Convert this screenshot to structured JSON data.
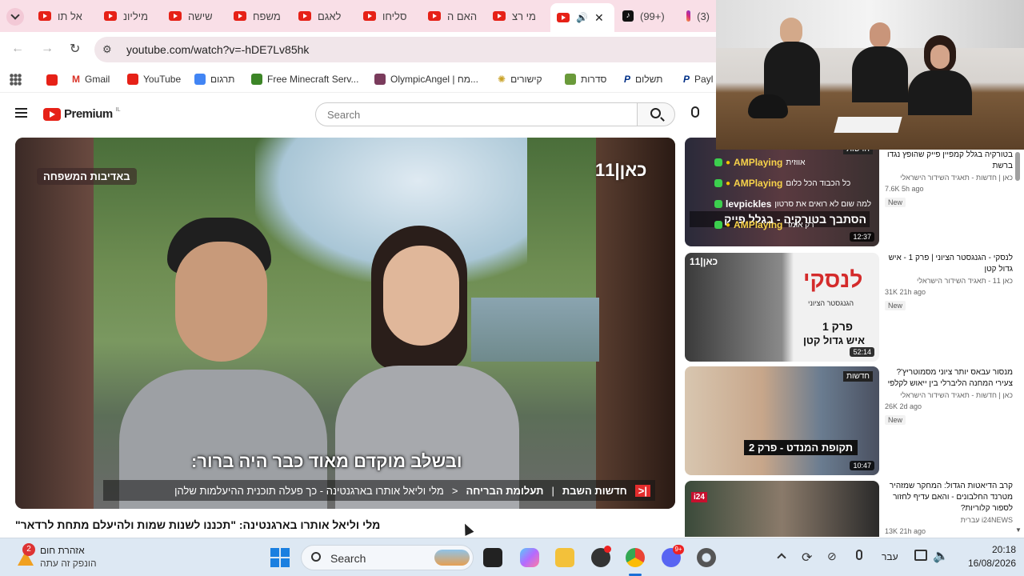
{
  "tabs": [
    {
      "label": "אל תו"
    },
    {
      "label": "מיליונ"
    },
    {
      "label": "שישה"
    },
    {
      "label": "משפח"
    },
    {
      "label": "לאגם"
    },
    {
      "label": "סליחו"
    },
    {
      "label": "האם ה"
    },
    {
      "label": "מי רצ"
    },
    {
      "label": ""
    },
    {
      "label": "(99+)"
    },
    {
      "label": "(3)"
    }
  ],
  "address": {
    "url": "youtube.com/watch?v=-hDE7Lv85hk"
  },
  "bookmarks": [
    {
      "label": "Gmail"
    },
    {
      "label": "YouTube"
    },
    {
      "label": "תרגום"
    },
    {
      "label": "Free Minecraft Serv..."
    },
    {
      "label": "OlympicAngel | מח..."
    },
    {
      "label": "קישורים"
    },
    {
      "label": "סדרות"
    },
    {
      "label": "תשלום"
    },
    {
      "label": "Payl"
    }
  ],
  "yt": {
    "brand": "Premium",
    "region": "IL",
    "search_placeholder": "Search"
  },
  "player": {
    "corner_tag": "באדיבות המשפחה",
    "channel_logo": "כאן|11",
    "subtitle": "ובשלב מוקדם מאוד כבר היה ברור:",
    "ticker_source": "חדשות השבת",
    "ticker_section": "תעלומת הבריחה",
    "ticker_text": "מלי וליאל אותרו בארגנטינה - כך פעלה תוכנית ההיעלמות שלהן"
  },
  "video_title": "\"מלי וליאל אותרו בארגנטינה: \"תכננו לשנות שמות ולהיעלם מתחת לרדאר",
  "overlay": {
    "chat_lines": [
      {
        "user": "AMPlaying",
        "text": "אווזית"
      },
      {
        "user": "AMPlaying",
        "text": "כל הכבוד הכל כלום"
      },
      {
        "user": "levpickles",
        "text": "למה שום לא רואים את סרטון"
      },
      {
        "user": "AMPlaying",
        "text": "רק אומר"
      }
    ]
  },
  "sidebar": [
    {
      "title": "בטורקיה בגלל קמפיין פייק שהופץ נגדו ברשת",
      "channel": "כאן | חדשות - תאגיד השידור הישראלי",
      "meta": "7.6K  5h ago",
      "badge": "New",
      "duration": "12:37",
      "thumb_text": "הסתבך בטורקיה - בגלל פייק",
      "thumb_tag": "חדשות"
    },
    {
      "title": "לנסקי - הגנגסטר הציוני | פרק 1 - איש גדול קטן",
      "channel": "כאן 11 - תאגיד השידור הישראלי",
      "meta": "31K  21h ago",
      "badge": "New",
      "duration": "52:14",
      "thumb_text": "לנסקי",
      "thumb_sub": "הגנגסטר הציוני",
      "thumb_ep": "פרק 1",
      "thumb_ep_sub": "איש גדול קטן",
      "thumb_logo": "כאן|11"
    },
    {
      "title": "מנסור עבאס יותר ציוני מסמוטריץ'? צעירי המחנה הליברלי בין ייאוש לקלפי",
      "channel": "כאן | חדשות - תאגיד השידור הישראלי",
      "meta": "26K  2d ago",
      "badge": "New",
      "duration": "10:47",
      "thumb_text": "תקופת המנדט - פרק 2",
      "thumb_tag": "חדשות"
    },
    {
      "title": "קרב הדיאטות הגדול: המחקר שמזהיר מטרנד החלבונים - והאם עדיף לחזור לספור קלוריות?",
      "channel": "i24NEWS עברית",
      "meta": "13K  21h ago",
      "thumb_logo": "i24"
    }
  ],
  "taskbar": {
    "weather_title": "אזהרת חום",
    "weather_sub": "הונפק זה עתה",
    "weather_badge": "2",
    "search_label": "Search",
    "lang": "עבר",
    "time": "20:18",
    "date": "16/08/2026",
    "discord_badge": "9+"
  },
  "colors": {
    "tabstrip": "#f9dfe7",
    "yt_red": "#e62117",
    "taskbar": "#dde8f3"
  }
}
